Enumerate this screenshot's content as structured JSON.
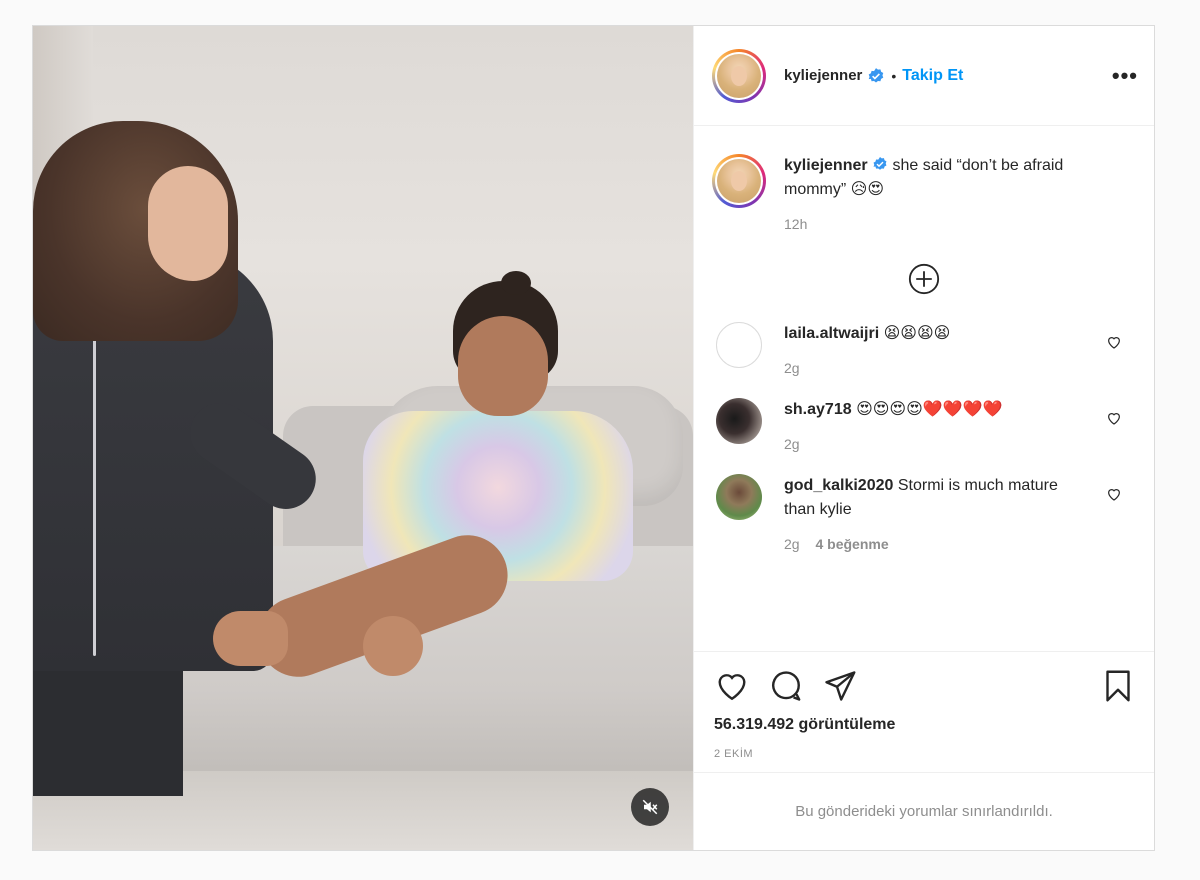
{
  "post": {
    "username": "kyliejenner",
    "dot": "•",
    "follow_label": "Takip Et",
    "more_label": "•••",
    "caption": {
      "username": "kyliejenner",
      "text": "she said “don’t be afraid mommy” 😥😍",
      "time": "12h"
    },
    "comments": [
      {
        "username": "laila.altwaijri",
        "text": "😫😫😫😫",
        "time": "2g",
        "likes": ""
      },
      {
        "username": "sh.ay718",
        "text": "😍😍😍😍❤️❤️❤️❤️",
        "time": "2g",
        "likes": ""
      },
      {
        "username": "god_kalki2020",
        "text": "Stormi is much mature than kylie",
        "time": "2g",
        "likes": "4 beğenme"
      }
    ],
    "views": "56.319.492 görüntüleme",
    "date": "2 EKİM",
    "restricted_text": "Bu gönderideki yorumlar sınırlandırıldı."
  },
  "icons": {
    "verified": "verified-badge-icon",
    "more": "more-options-icon",
    "load_more": "plus-circle-icon",
    "like": "heart-icon",
    "comment": "comment-icon",
    "share": "send-icon",
    "save": "bookmark-icon",
    "mute": "speaker-muted-icon"
  },
  "colors": {
    "link": "#0095f6",
    "verified": "#3897f0",
    "secondary_text": "#8e8e8e",
    "primary_text": "#262626"
  }
}
